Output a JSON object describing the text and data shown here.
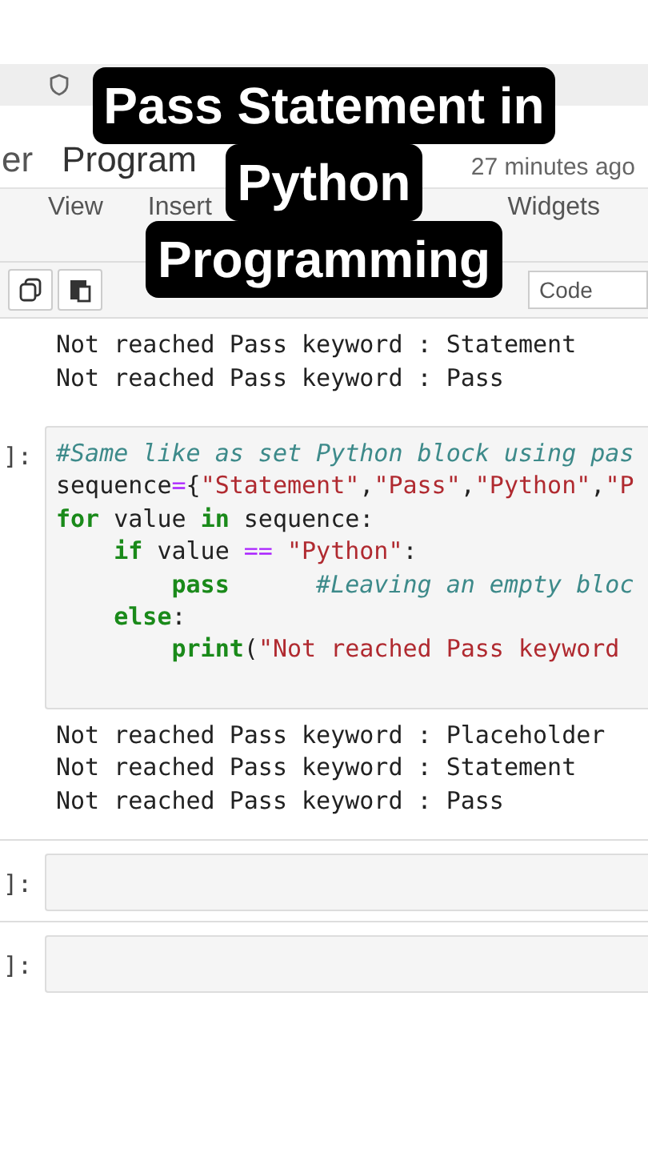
{
  "header": {
    "left_text": "er",
    "notebook_name": "Program",
    "saved": "27 minutes ago"
  },
  "menu": [
    {
      "label": "View"
    },
    {
      "label": "Insert"
    },
    {
      "label": "Widgets"
    }
  ],
  "toolbar": {
    "cell_type": "Code"
  },
  "previous_output": [
    "Not reached Pass keyword : Statement",
    "Not reached Pass keyword : Pass"
  ],
  "cells": [
    {
      "prompt": "]:",
      "lines": [
        [
          {
            "kind": "comment",
            "text": "#Same like as set Python block using pas"
          }
        ],
        [
          {
            "kind": "plain",
            "text": "sequence"
          },
          {
            "kind": "operator",
            "text": "="
          },
          {
            "kind": "plain",
            "text": "{"
          },
          {
            "kind": "string",
            "text": "\"Statement\""
          },
          {
            "kind": "plain",
            "text": ","
          },
          {
            "kind": "string",
            "text": "\"Pass\""
          },
          {
            "kind": "plain",
            "text": ","
          },
          {
            "kind": "string",
            "text": "\"Python\""
          },
          {
            "kind": "plain",
            "text": ","
          },
          {
            "kind": "string",
            "text": "\"P"
          }
        ],
        [
          {
            "kind": "keyword",
            "text": "for"
          },
          {
            "kind": "plain",
            "text": " value "
          },
          {
            "kind": "keyword",
            "text": "in"
          },
          {
            "kind": "plain",
            "text": " sequence:"
          }
        ],
        [
          {
            "kind": "keyword",
            "text": "    if"
          },
          {
            "kind": "plain",
            "text": " value "
          },
          {
            "kind": "operator",
            "text": "=="
          },
          {
            "kind": "string",
            "text": " \"Python\""
          },
          {
            "kind": "plain",
            "text": ":"
          }
        ],
        [
          {
            "kind": "keyword",
            "text": "        pass"
          },
          {
            "kind": "comment",
            "text": "      #Leaving an empty bloc"
          }
        ],
        [
          {
            "kind": "keyword",
            "text": "    else"
          },
          {
            "kind": "plain",
            "text": ":"
          }
        ],
        [
          {
            "kind": "builtin",
            "text": "        print"
          },
          {
            "kind": "plain",
            "text": "("
          },
          {
            "kind": "string",
            "text": "\"Not reached Pass keyword"
          }
        ]
      ],
      "output": [
        "Not reached Pass keyword : Placeholder",
        "Not reached Pass keyword : Statement",
        "Not reached Pass keyword : Pass"
      ]
    },
    {
      "prompt": "]:"
    },
    {
      "prompt": "]:"
    }
  ],
  "caption": [
    "Pass Statement in",
    "Python",
    "Programming"
  ]
}
